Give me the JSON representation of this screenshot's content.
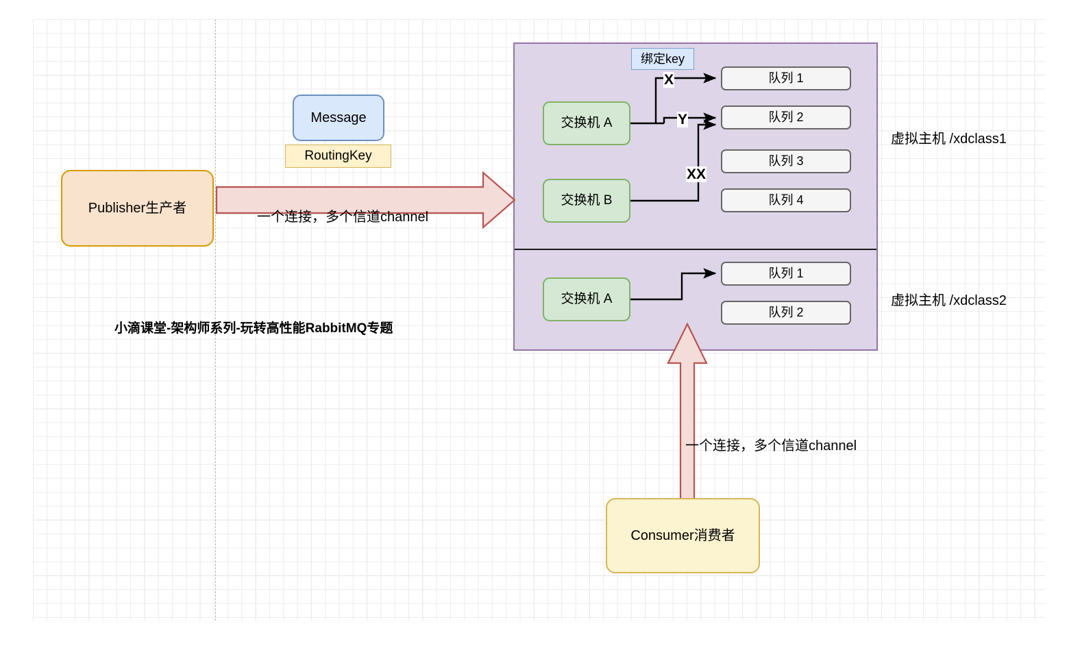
{
  "diagram": {
    "watermark": "小滴课堂-架构师系列-玩转高性能RabbitMQ专题",
    "colors": {
      "vhost_fill": "#ded5e8",
      "vhost_border": "#9673a6",
      "exchange_fill": "#d5e8d4",
      "exchange_border": "#82b366",
      "queue_fill": "#f5f5f5",
      "queue_border": "#666666",
      "message_fill": "#dae8fc",
      "message_border": "#6c8ebf",
      "routingkey_fill": "#fff2cc",
      "routingkey_border": "#d6b656",
      "publisher_fill": "#fae3cd",
      "publisher_border": "#d79b00",
      "consumer_fill": "#fcf3d0",
      "consumer_border": "#d6b656",
      "arrow_fill": "#f4dcd9",
      "arrow_border": "#b85450",
      "connector": "#000000"
    }
  },
  "publisher": {
    "label": "Publisher生产者",
    "channel_note": "一个连接，多个信道channel"
  },
  "message": {
    "label": "Message",
    "routing_key_label": "RoutingKey"
  },
  "binding": {
    "title": "绑定key",
    "keys": {
      "x": "X",
      "y": "Y",
      "xx": "XX"
    }
  },
  "vhost1": {
    "label": "虚拟主机 /xdclass1",
    "exchanges": [
      {
        "label": "交换机 A"
      },
      {
        "label": "交换机 B"
      }
    ],
    "queues": [
      {
        "label": "队列 1"
      },
      {
        "label": "队列 2"
      },
      {
        "label": "队列 3"
      },
      {
        "label": "队列 4"
      }
    ]
  },
  "vhost2": {
    "label": "虚拟主机 /xdclass2",
    "exchanges": [
      {
        "label": "交换机 A"
      }
    ],
    "queues": [
      {
        "label": "队列 1"
      },
      {
        "label": "队列 2"
      }
    ]
  },
  "consumer": {
    "label": "Consumer消费者",
    "channel_note": "一个连接，多个信道channel"
  }
}
